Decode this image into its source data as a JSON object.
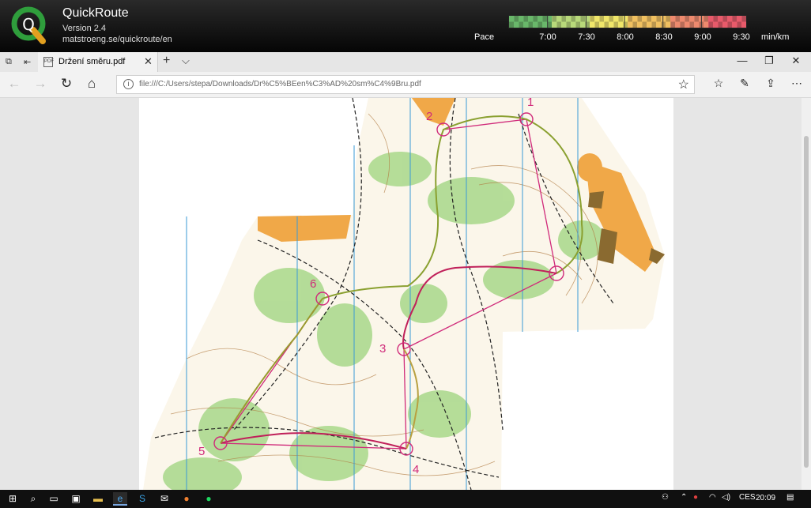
{
  "quickroute": {
    "title": "QuickRoute",
    "version": "Version 2.4",
    "url": "matstroeng.se/quickroute/en",
    "logo_letter": "Q",
    "pace_label": "Pace",
    "pace_ticks": [
      "7:00",
      "7:30",
      "8:00",
      "8:30",
      "9:00",
      "9:30"
    ],
    "pace_unit": "min/km",
    "pace_colors": [
      "#69b86a",
      "#b8d97a",
      "#f0e66a",
      "#f0c060",
      "#ee8a6e",
      "#e85a6a"
    ]
  },
  "browser": {
    "tab_title": "Držení směru.pdf",
    "tab_favicon": "PDF",
    "address_url": "file:///C:/Users/stepa/Downloads/Dr%C5%BEen%C3%AD%20sm%C4%9Bru.pdf"
  },
  "map": {
    "controls": [
      "1",
      "2",
      "3",
      "4",
      "5",
      "6"
    ],
    "route_color": "#c0205a",
    "course_color": "#d02a7a"
  },
  "taskbar": {
    "language": "CES",
    "time": "20:09"
  }
}
